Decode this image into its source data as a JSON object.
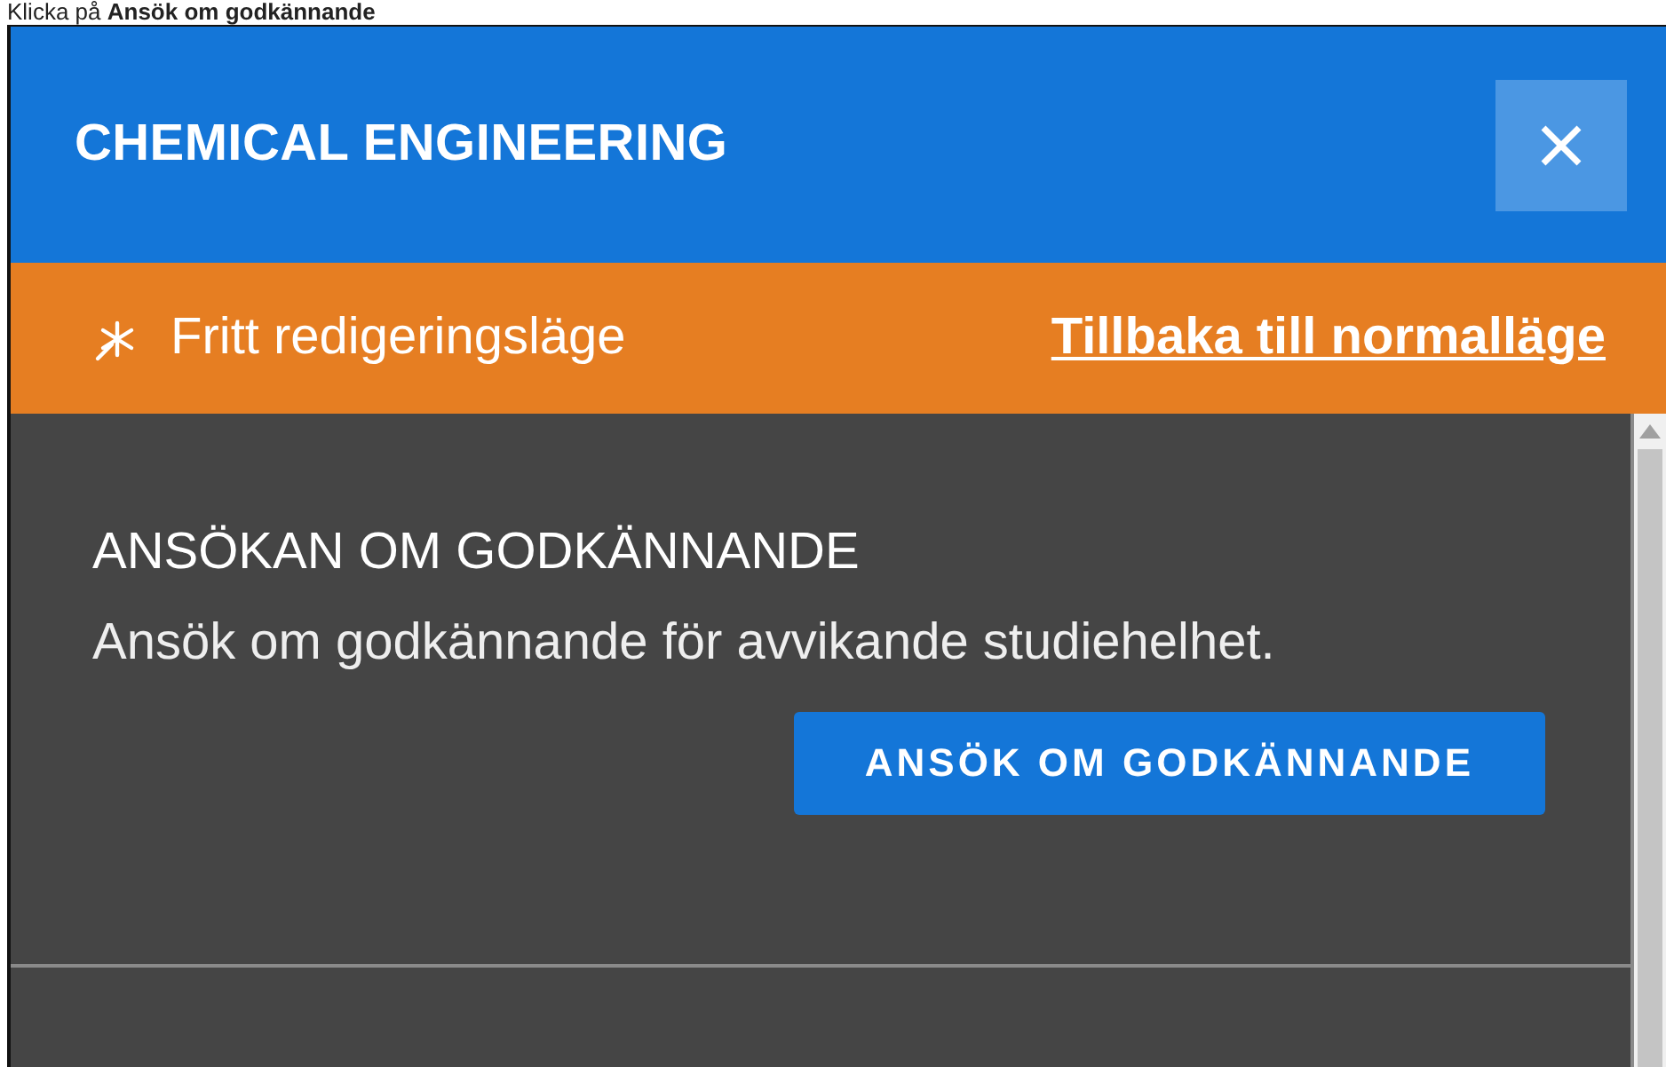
{
  "instruction": "Klicka på **Ansök om godkännande**",
  "panel": {
    "title": "CHEMICAL ENGINEERING"
  },
  "mode_bar": {
    "label": "Fritt redigeringsläge",
    "link": "Tillbaka till normalläge"
  },
  "section": {
    "heading": "ANSÖKAN OM GODKÄNNANDE",
    "description": "Ansök om godkännande för avvikande studiehelhet.",
    "button": "ANSÖK OM GODKÄNNANDE"
  }
}
